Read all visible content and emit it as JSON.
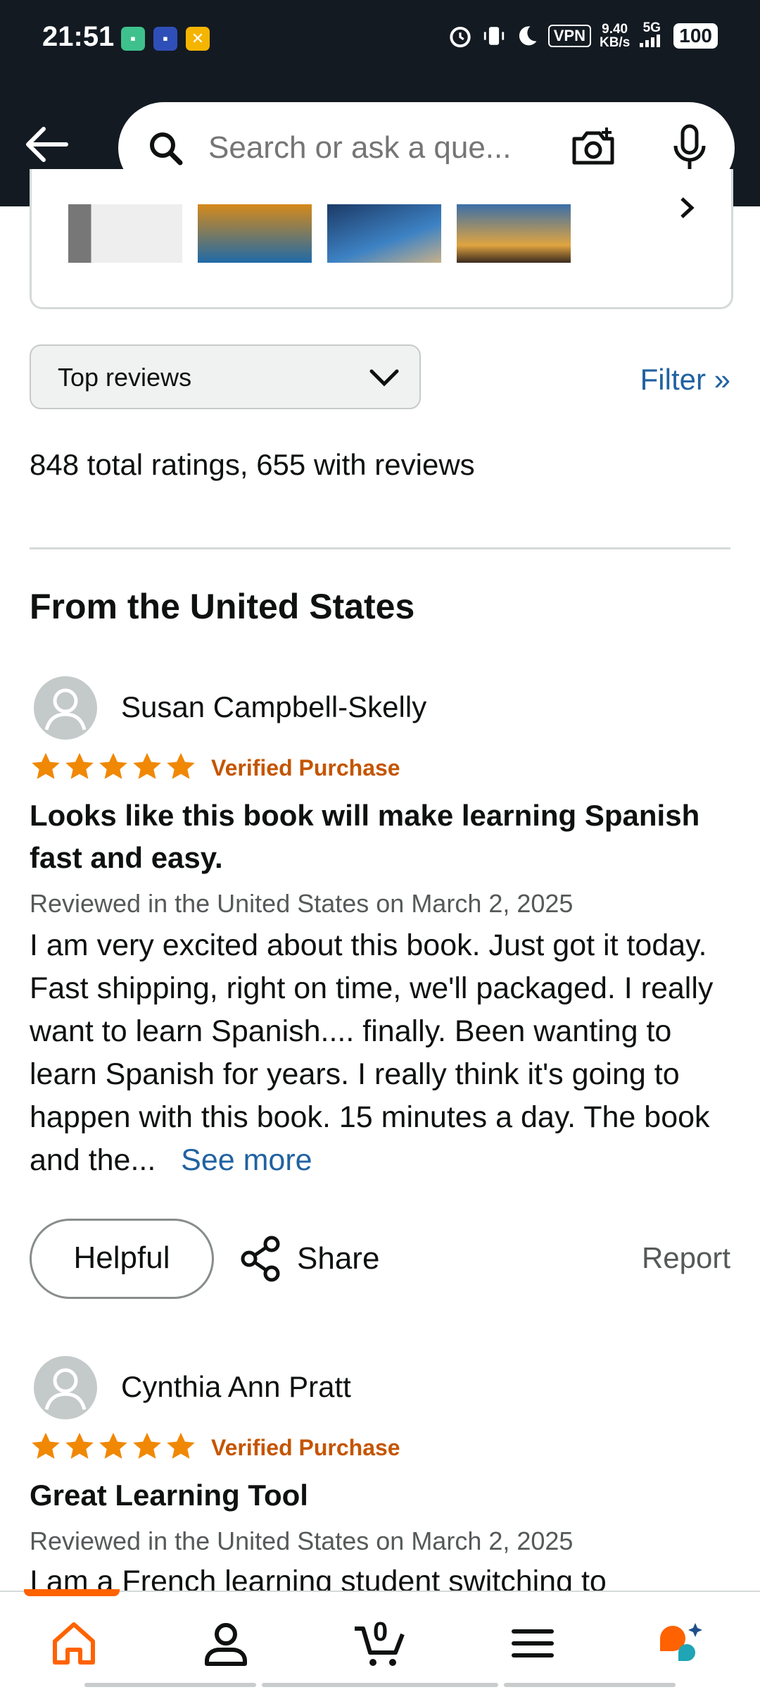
{
  "status": {
    "time": "21:51",
    "vpn": "VPN",
    "net_speed_value": "9.40",
    "net_speed_unit": "KB/s",
    "signal_label": "5G",
    "battery": "100"
  },
  "header": {
    "search_placeholder": "Search or ask a que..."
  },
  "sort": {
    "selected": "Top reviews",
    "filter_label": "Filter »"
  },
  "summary": {
    "text": "848 total ratings, 655 with reviews"
  },
  "section": {
    "title": "From the United States"
  },
  "reviews": [
    {
      "name": "Susan Campbell-Skelly",
      "rating": 5,
      "verified": "Verified Purchase",
      "title": "Looks like this book will make learning Spanish fast and easy.",
      "meta": "Reviewed in the United States on March 2, 2025",
      "body": "I am very excited about this book. Just got it today. Fast shipping, right on time, we'll packaged. I really want to learn Spanish.... finally. Been wanting to learn Spanish for years. I really think it's going to happen with this book. 15 minutes a day. The book and the...",
      "see_more": "See more",
      "helpful": "Helpful",
      "share": "Share",
      "report": "Report"
    },
    {
      "name": "Cynthia Ann Pratt",
      "rating": 5,
      "verified": "Verified Purchase",
      "title": "Great Learning Tool",
      "meta": "Reviewed in the United States on March 2, 2025",
      "body": "I am a French learning student switching to"
    }
  ],
  "nav": {
    "cart_count": "0",
    "accent": "#ff6200"
  },
  "colors": {
    "header_bg": "#131a22",
    "link": "#2162a1",
    "verified": "#c45500",
    "star": "#f08804"
  }
}
